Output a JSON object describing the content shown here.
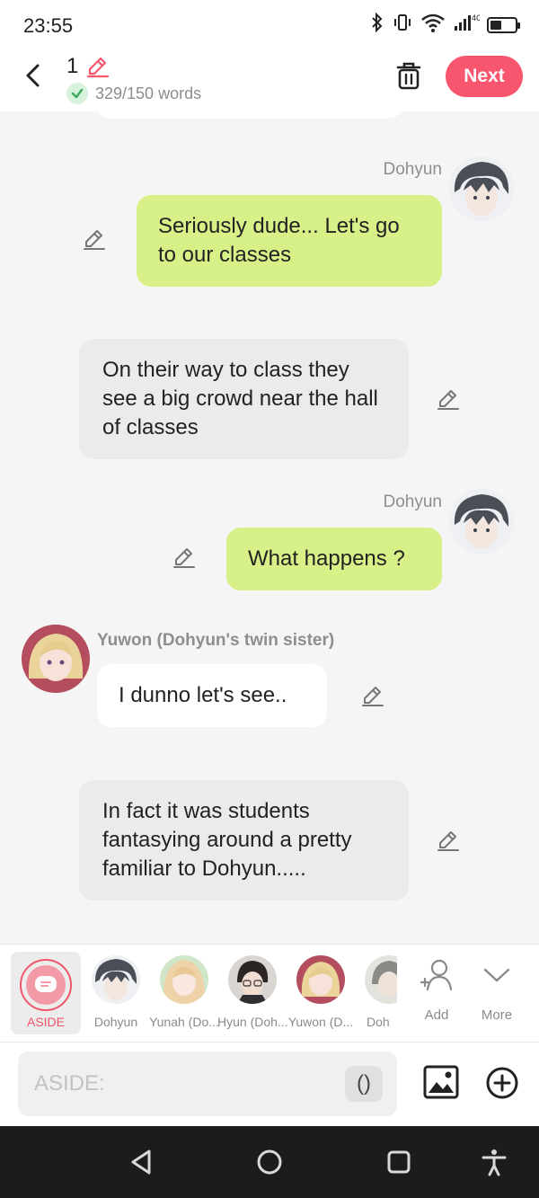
{
  "status_bar": {
    "time": "23:55",
    "network": "4G"
  },
  "header": {
    "chapter_number": "1",
    "word_count": "329/150 words",
    "next_label": "Next"
  },
  "messages": [
    {
      "type": "character",
      "side": "right",
      "name": "Dohyun",
      "text": "Seriously dude... Let's go to our classes"
    },
    {
      "type": "narration",
      "text": "On their way to class they see a big crowd near the hall of classes"
    },
    {
      "type": "character",
      "side": "right",
      "name": "Dohyun",
      "text": "What happens ?"
    },
    {
      "type": "character",
      "side": "left",
      "name": "Yuwon (Dohyun's twin sister)",
      "text": "I dunno let's see.."
    },
    {
      "type": "narration",
      "text": "In fact it was students fantasying around a pretty familiar to Dohyun....."
    }
  ],
  "character_bar": {
    "aside_label": "ASIDE",
    "characters": [
      "Dohyun",
      "Yunah (Do...",
      "Hyun (Doh...",
      "Yuwon (D...",
      "Doh"
    ],
    "add_label": "Add",
    "more_label": "More"
  },
  "input": {
    "placeholder": "ASIDE:",
    "paren_label": "()"
  },
  "colors": {
    "accent": "#f7566e",
    "green_bubble": "#d8f088",
    "narration_bubble": "#ebebeb"
  }
}
